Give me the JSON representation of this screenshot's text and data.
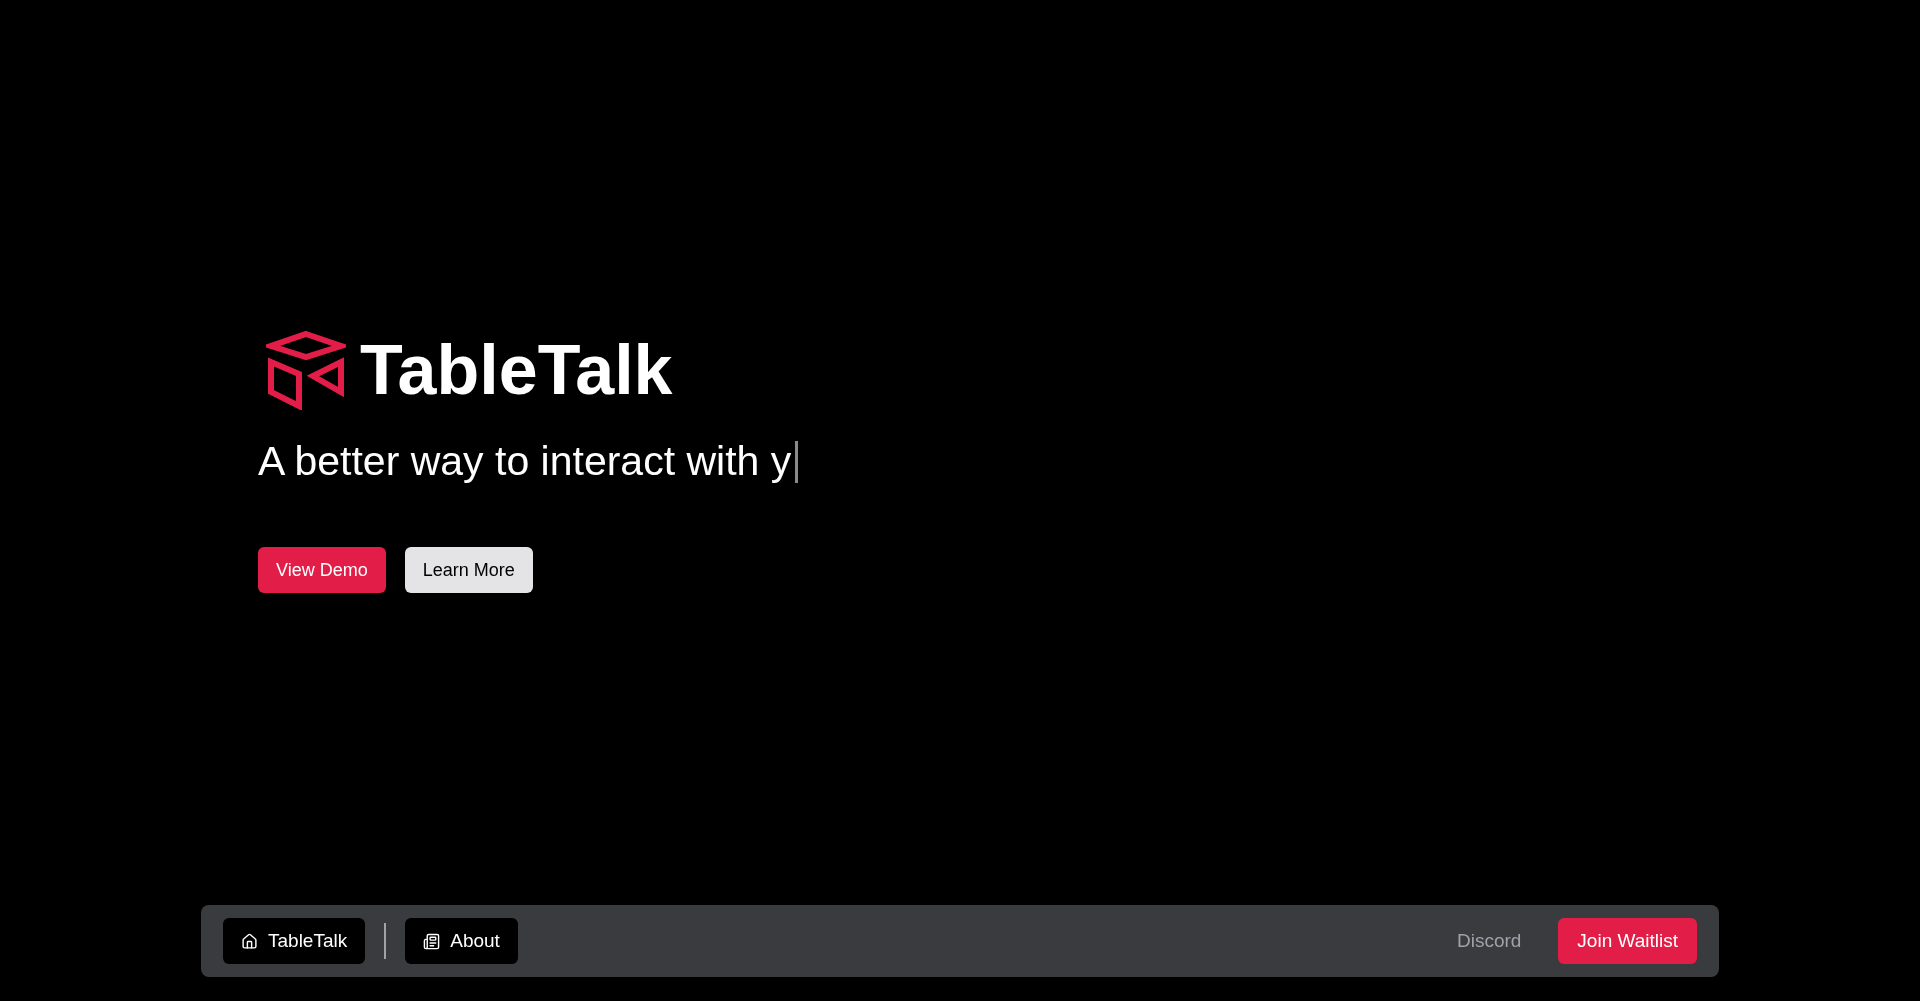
{
  "hero": {
    "title": "TableTalk",
    "tagline": "A better way to interact with y",
    "cursor": true,
    "buttons": [
      {
        "label": "View Demo",
        "kind": "primary"
      },
      {
        "label": "Learn More",
        "kind": "secondary"
      }
    ]
  },
  "navbar": {
    "left": [
      {
        "label": "TableTalk"
      },
      {
        "label": "About"
      }
    ],
    "right": [
      {
        "label": "Discord",
        "kind": "link"
      },
      {
        "label": "Join Waitlist",
        "kind": "primary"
      }
    ]
  }
}
